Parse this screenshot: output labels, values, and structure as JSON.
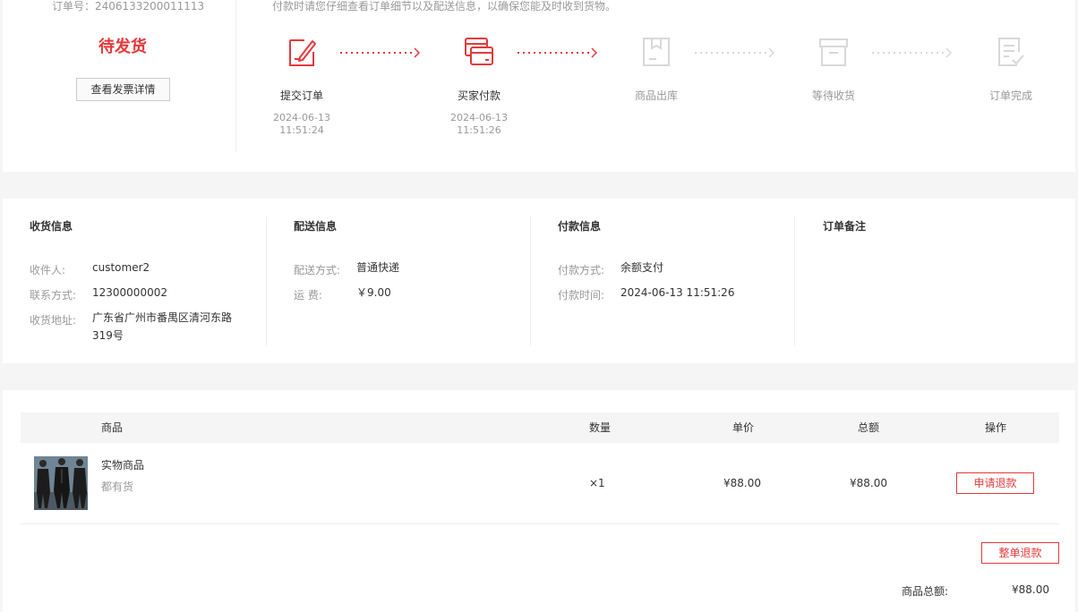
{
  "status": {
    "order_no": "订单号：2406133200011113",
    "order_status": "待发货",
    "invoice_button": "查看发票详情",
    "pay_tip": "付款时请您仔细查看订单细节以及配送信息，以确保您能及时收到货物。",
    "steps": [
      {
        "label": "提交订单",
        "date": "2024-06-13",
        "time": "11:51:24",
        "icon": "edit-order-icon",
        "active": true
      },
      {
        "label": "买家付款",
        "date": "2024-06-13",
        "time": "11:51:26",
        "icon": "card-pay-icon",
        "active": true
      },
      {
        "label": "商品出库",
        "date": "",
        "time": "",
        "icon": "box-out-icon",
        "active": false
      },
      {
        "label": "等待收货",
        "date": "",
        "time": "",
        "icon": "archive-icon",
        "active": false
      },
      {
        "label": "订单完成",
        "date": "",
        "time": "",
        "icon": "doc-check-icon",
        "active": false
      }
    ],
    "active_color": "#e4393c",
    "inactive_color": "#d8d8d8"
  },
  "info": {
    "receiver": {
      "title": "收货信息",
      "name_key": "收件人:",
      "name_val": "customer2",
      "phone_key": "联系方式:",
      "phone_val": "12300000002",
      "addr_key": "收货地址:",
      "addr_line1": "广东省广州市番禺区清河东路",
      "addr_line2": "319号"
    },
    "delivery": {
      "title": "配送信息",
      "method_key": "配送方式:",
      "method_val": "普通快递",
      "fee_key": "运 费:",
      "fee_val": "￥9.00"
    },
    "payment": {
      "title": "付款信息",
      "method_key": "付款方式:",
      "method_val": "余额支付",
      "time_key": "付款时间:",
      "time_val": "2024-06-13 11:51:26"
    },
    "remark": {
      "title": "订单备注"
    }
  },
  "goods": {
    "headers": [
      "商品",
      "数量",
      "单价",
      "总额",
      "操作"
    ],
    "items": [
      {
        "name": "实物商品",
        "stock": "都有货",
        "qty": "×1",
        "price": "¥88.00",
        "total": "¥88.00",
        "action": "申请退款"
      }
    ],
    "full_refund_button": "整单退款",
    "total_label": "商品总额:",
    "total_value": "¥88.00"
  }
}
